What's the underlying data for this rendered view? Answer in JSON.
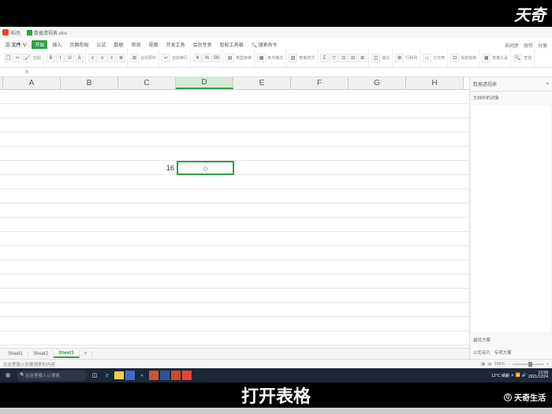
{
  "titlebar": {
    "app_label": "稻壳",
    "file_name": "数据透视表.xlsx"
  },
  "ribbon": {
    "tabs": [
      "开始",
      "插入",
      "页面布局",
      "公式",
      "数据",
      "审阅",
      "视图",
      "开发工具",
      "会员专享",
      "智能工具箱"
    ],
    "search_placeholder": "搜索命令",
    "extras": [
      "未同步",
      "协作",
      "分享"
    ]
  },
  "toolbar": {
    "groups": [
      {
        "label": "剪贴",
        "items": [
          "📋",
          "✂",
          "🖌"
        ]
      },
      {
        "label": "",
        "items": [
          "B",
          "I",
          "U",
          "A"
        ]
      },
      {
        "label": "",
        "items": [
          "≡",
          "≡",
          "≡",
          "≣"
        ]
      },
      {
        "label": "合并居中",
        "items": [
          "⊞"
        ]
      },
      {
        "label": "自动换行",
        "items": [
          "↩"
        ]
      },
      {
        "label": "",
        "items": [
          "¥",
          "%",
          "00"
        ]
      },
      {
        "label": "类型转换",
        "items": [
          "▤"
        ]
      },
      {
        "label": "条件格式",
        "items": [
          "▦"
        ]
      },
      {
        "label": "表格样式",
        "items": [
          "▨"
        ]
      },
      {
        "label": "",
        "items": [
          "Σ",
          "▽",
          "⊡",
          "⊟",
          "⊞"
        ]
      },
      {
        "label": "填充",
        "items": [
          "◫"
        ]
      },
      {
        "label": "行和列",
        "items": [
          "⊞"
        ]
      },
      {
        "label": "工作表",
        "items": [
          "▭"
        ]
      },
      {
        "label": "冻结窗格",
        "items": [
          "⊡"
        ]
      },
      {
        "label": "表格工具",
        "items": [
          "▦"
        ]
      },
      {
        "label": "查找",
        "items": [
          "🔍"
        ]
      }
    ]
  },
  "formula_bar": {
    "cell_ref": "",
    "fx": "fx"
  },
  "columns": [
    "A",
    "B",
    "C",
    "D",
    "E",
    "F",
    "G",
    "H"
  ],
  "active_col": "D",
  "cell_value": "16",
  "sidepanel": {
    "title": "数据透视表",
    "close": "×",
    "section": "文档中的对象",
    "footer_title": "最佳方案",
    "footer_links": [
      "公司名片",
      "专项方案"
    ]
  },
  "sheets": [
    "Sheet1",
    "Sheet2",
    "Sheet3"
  ],
  "active_sheet": "Sheet3",
  "status": {
    "hint": "在这里输入你要搜索的内容",
    "zoom": "298%"
  },
  "taskbar": {
    "search": "在这里输入以搜索",
    "weather": "12°C 晴朗",
    "time": "13:58",
    "date": "2021/12/24"
  },
  "caption": "打开表格",
  "watermark": "天奇生活",
  "brand_corner": "天奇"
}
